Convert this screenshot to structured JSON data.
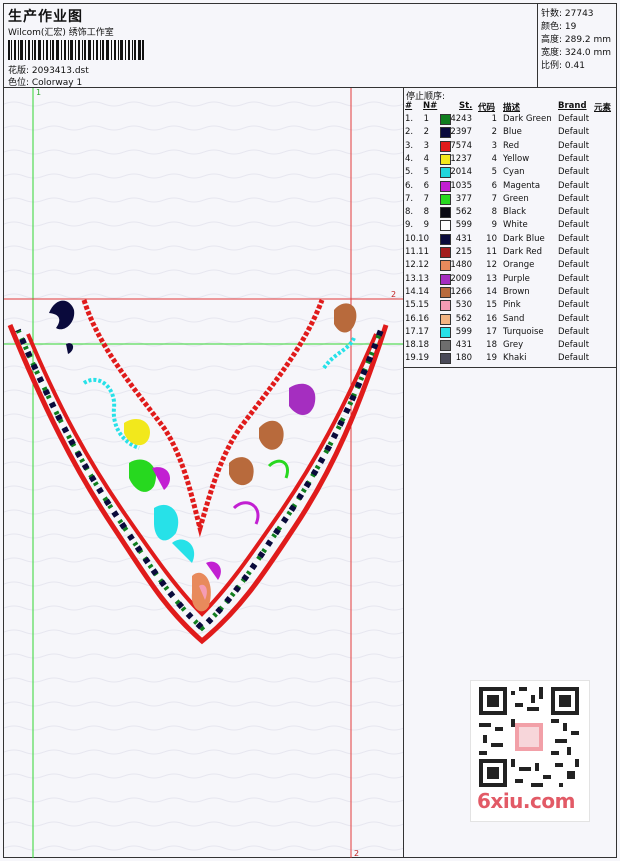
{
  "header": {
    "title": "生产作业图",
    "subtitle": "Wilcom(汇宏) 绣饰工作室",
    "design_label": "花版: 2093413.dst",
    "color_label": "色位: Colorway 1"
  },
  "stats": [
    {
      "label": "针数: 27743"
    },
    {
      "label": "颜色: 19"
    },
    {
      "label": "高度: 289.2 mm"
    },
    {
      "label": "宽度: 324.0 mm"
    },
    {
      "label": "比例: 0.41"
    }
  ],
  "guides": {
    "label_1_top": "1",
    "label_2_right": "2",
    "label_2_bottom": "2"
  },
  "stop_sequence": {
    "title": "停止顺序:",
    "columns": [
      "#",
      "N#",
      "St.",
      "代码",
      "描述",
      "Brand",
      "元素"
    ],
    "rows": [
      {
        "idx": "1.",
        "n": "1",
        "st": "4243",
        "code": "1",
        "desc": "Dark Green",
        "brand": "Default",
        "color": "#0f7d1e"
      },
      {
        "idx": "2.",
        "n": "2",
        "st": "2397",
        "code": "2",
        "desc": "Blue",
        "brand": "Default",
        "color": "#0a0a3c"
      },
      {
        "idx": "3.",
        "n": "3",
        "st": "7574",
        "code": "3",
        "desc": "Red",
        "brand": "Default",
        "color": "#e01b1b"
      },
      {
        "idx": "4.",
        "n": "4",
        "st": "1237",
        "code": "4",
        "desc": "Yellow",
        "brand": "Default",
        "color": "#f2e81c"
      },
      {
        "idx": "5.",
        "n": "5",
        "st": "2014",
        "code": "5",
        "desc": "Cyan",
        "brand": "Default",
        "color": "#21d6dc"
      },
      {
        "idx": "6.",
        "n": "6",
        "st": "1035",
        "code": "6",
        "desc": "Magenta",
        "brand": "Default",
        "color": "#c21fd2"
      },
      {
        "idx": "7.",
        "n": "7",
        "st": "377",
        "code": "7",
        "desc": "Green",
        "brand": "Default",
        "color": "#27d81f"
      },
      {
        "idx": "8.",
        "n": "8",
        "st": "562",
        "code": "8",
        "desc": "Black",
        "brand": "Default",
        "color": "#0a0a14"
      },
      {
        "idx": "9.",
        "n": "9",
        "st": "599",
        "code": "9",
        "desc": "White",
        "brand": "Default",
        "color": "#ffffff"
      },
      {
        "idx": "10.",
        "n": "10",
        "st": "431",
        "code": "10",
        "desc": "Dark Blue",
        "brand": "Default",
        "color": "#0a0a3a"
      },
      {
        "idx": "11.",
        "n": "11",
        "st": "215",
        "code": "11",
        "desc": "Dark Red",
        "brand": "Default",
        "color": "#a31d1d"
      },
      {
        "idx": "12.",
        "n": "12",
        "st": "1480",
        "code": "12",
        "desc": "Orange",
        "brand": "Default",
        "color": "#e88a5c"
      },
      {
        "idx": "13.",
        "n": "13",
        "st": "2009",
        "code": "13",
        "desc": "Purple",
        "brand": "Default",
        "color": "#a52ec0"
      },
      {
        "idx": "14.",
        "n": "14",
        "st": "1266",
        "code": "14",
        "desc": "Brown",
        "brand": "Default",
        "color": "#b86a3c"
      },
      {
        "idx": "15.",
        "n": "15",
        "st": "530",
        "code": "15",
        "desc": "Pink",
        "brand": "Default",
        "color": "#f59cb4"
      },
      {
        "idx": "16.",
        "n": "16",
        "st": "562",
        "code": "16",
        "desc": "Sand",
        "brand": "Default",
        "color": "#f2b482"
      },
      {
        "idx": "17.",
        "n": "17",
        "st": "599",
        "code": "17",
        "desc": "Turquoise",
        "brand": "Default",
        "color": "#27e1e8"
      },
      {
        "idx": "18.",
        "n": "18",
        "st": "431",
        "code": "18",
        "desc": "Grey",
        "brand": "Default",
        "color": "#6e6e6e"
      },
      {
        "idx": "19.",
        "n": "19",
        "st": "180",
        "code": "19",
        "desc": "Khaki",
        "brand": "Default",
        "color": "#4a4a58"
      }
    ]
  },
  "watermark": {
    "text": "6xiu.com"
  }
}
